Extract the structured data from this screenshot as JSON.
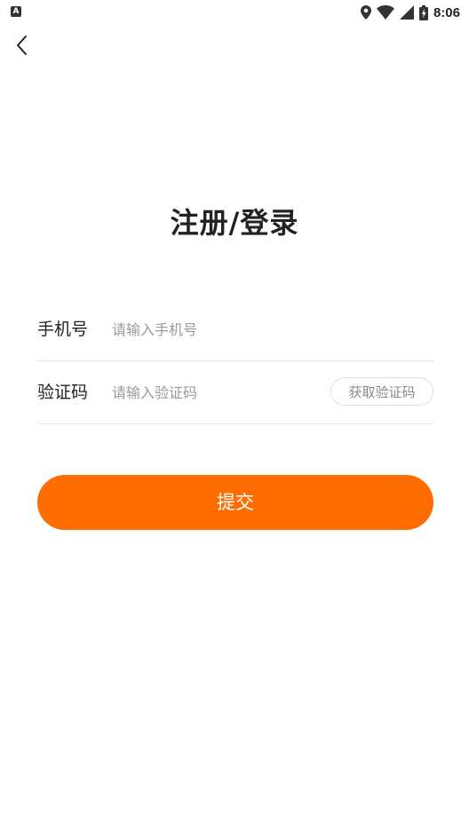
{
  "status_bar": {
    "app_icon_letter": "A",
    "time": "8:06"
  },
  "page": {
    "title": "注册/登录"
  },
  "form": {
    "phone": {
      "label": "手机号",
      "placeholder": "请输入手机号",
      "value": ""
    },
    "code": {
      "label": "验证码",
      "placeholder": "请输入验证码",
      "value": "",
      "get_code_label": "获取验证码"
    },
    "submit_label": "提交"
  },
  "colors": {
    "accent": "#ff6c02",
    "divider": "#e6e6e6",
    "placeholder": "#9a9a9a"
  },
  "icons": {
    "status": [
      "app-notification-icon",
      "location-icon",
      "wifi-icon",
      "signal-icon",
      "battery-icon"
    ],
    "back": "back-arrow-icon"
  }
}
